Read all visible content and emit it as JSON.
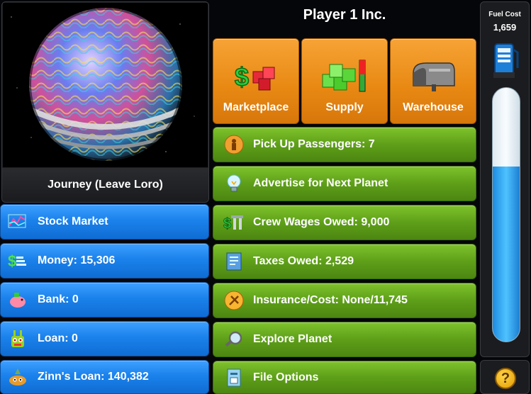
{
  "company": {
    "name": "Player 1 Inc."
  },
  "left_panel": {
    "journey_label": "Journey (Leave Loro)",
    "buttons": [
      {
        "label": "Stock Market",
        "icon": "stock-chart-icon"
      },
      {
        "label": "Money: 15,306",
        "icon": "money-stack-icon"
      },
      {
        "label": "Bank: 0",
        "icon": "piggy-bank-icon"
      },
      {
        "label": "Loan: 0",
        "icon": "loan-creature-icon"
      },
      {
        "label": "Zinn's Loan: 140,382",
        "icon": "zinn-creature-icon"
      }
    ]
  },
  "top_buttons": [
    {
      "label": "Marketplace",
      "icon": "dollar-crates-icon"
    },
    {
      "label": "Supply",
      "icon": "green-boxes-icon"
    },
    {
      "label": "Warehouse",
      "icon": "mailbox-icon"
    }
  ],
  "actions": [
    {
      "label": "Pick Up Passengers: 7",
      "icon": "passenger-icon"
    },
    {
      "label": "Advertise for Next Planet",
      "icon": "lightbulb-icon"
    },
    {
      "label": "Crew Wages Owed: 9,000",
      "icon": "wages-tools-icon"
    },
    {
      "label": "Taxes Owed: 2,529",
      "icon": "tax-document-icon"
    },
    {
      "label": "Insurance/Cost: None/11,745",
      "icon": "insurance-icon"
    },
    {
      "label": "Explore Planet",
      "icon": "magnifier-icon"
    },
    {
      "label": "File Options",
      "icon": "file-icon"
    }
  ],
  "fuel": {
    "cost_label": "Fuel Cost",
    "cost_value": "1,659",
    "level_fraction": 0.69
  },
  "help": {
    "label": "?"
  },
  "colors": {
    "blue_button": "#1b82ec",
    "green_button": "#5e9f19",
    "orange_button": "#e98a14",
    "fuel_fill": "#3aa9f2"
  }
}
